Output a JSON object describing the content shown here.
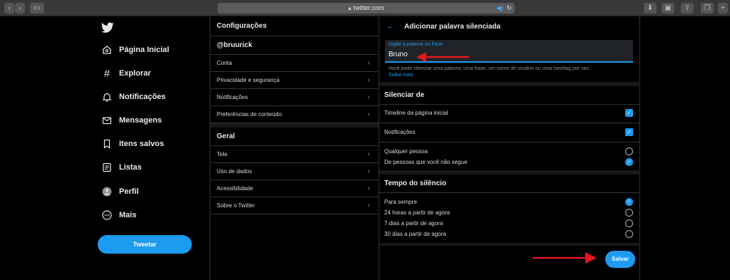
{
  "browser": {
    "url": "twitter.com"
  },
  "nav": {
    "items": [
      {
        "label": "Página Inicial",
        "icon": "home-icon"
      },
      {
        "label": "Explorar",
        "icon": "hashtag-icon"
      },
      {
        "label": "Notificações",
        "icon": "bell-icon"
      },
      {
        "label": "Mensagens",
        "icon": "envelope-icon"
      },
      {
        "label": "Itens salvos",
        "icon": "bookmark-icon"
      },
      {
        "label": "Listas",
        "icon": "list-icon"
      },
      {
        "label": "Perfil",
        "icon": "avatar-icon"
      },
      {
        "label": "Mais",
        "icon": "more-icon"
      }
    ],
    "tweet_label": "Tweetar"
  },
  "settings": {
    "title": "Configurações",
    "account_handle": "@bruurick",
    "account_items": [
      "Conta",
      "Privacidade e segurança",
      "Notificações",
      "Preferências de conteúdo"
    ],
    "general_title": "Geral",
    "general_items": [
      "Tela",
      "Uso de dados",
      "Acessibilidade",
      "Sobre o Twitter"
    ]
  },
  "mute": {
    "title": "Adicionar palavra silenciada",
    "field_label": "Digite a palavra ou frase",
    "field_value": "Bruno",
    "hint": "Você pode silenciar uma palavra, uma frase, um nome de usuário ou uma hashtag por vez.",
    "hint_link": "Saiba mais",
    "mute_from_title": "Silenciar de",
    "mute_from": {
      "home": {
        "label": "Timeline da página inicial",
        "checked": true
      },
      "notifications": {
        "label": "Notificações",
        "checked": true
      },
      "anyone": {
        "label": "Qualquer pessoa",
        "selected": false
      },
      "not_following": {
        "label": "De pessoas que você não segue",
        "selected": true
      }
    },
    "duration_title": "Tempo do silêncio",
    "duration": {
      "forever": {
        "label": "Para sempre",
        "selected": true
      },
      "h24": {
        "label": "24 horas a partir de agora",
        "selected": false
      },
      "d7": {
        "label": "7 dias a partir de agora",
        "selected": false
      },
      "d30": {
        "label": "30 dias a partir de agora",
        "selected": false
      }
    },
    "save_label": "Salvar"
  },
  "colors": {
    "accent": "#1d9bf0",
    "annotation_arrow": "#e0191b"
  }
}
